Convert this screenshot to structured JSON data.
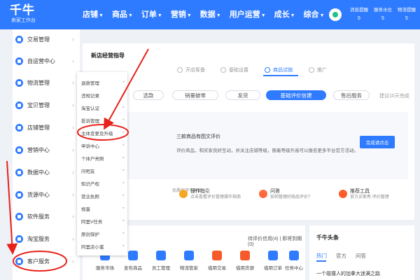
{
  "brand": {
    "logo": "千牛",
    "subtitle": "卖家工作台"
  },
  "nav": [
    "店铺",
    "商品",
    "订单",
    "营销",
    "数据",
    "用户运营",
    "成长",
    "综合"
  ],
  "user_stats": [
    {
      "label": "消息提醒",
      "value": "5"
    },
    {
      "label": "服务水位",
      "value": "5"
    },
    {
      "label": "物流提醒",
      "value": "5"
    }
  ],
  "sidebar": [
    "交易管理",
    "自运营中心",
    "物流管理",
    "宝贝管理",
    "店铺管理",
    "营销中心",
    "数据中心",
    "货源中心",
    "软件服务",
    "淘宝服务",
    "客户服务"
  ],
  "submenu": [
    "退款管理",
    "违规记录",
    "淘宝认证",
    "投诉管理",
    "主体变更及升级",
    "申诉中心",
    "个体户亮照",
    "问吧友",
    "知识产权",
    "营业执照",
    "规蛋",
    "阿里V任务",
    "原创保护",
    "阿里店小蜜"
  ],
  "main": {
    "section_title": "新店经营指导",
    "steps": [
      "开店筹备",
      "基础设置",
      "商品试销",
      "推广"
    ],
    "stages": [
      "选款",
      "销量破零",
      "发货",
      "基础评价信建",
      "售后服务"
    ],
    "stage_note": "建议10天完成",
    "task_line1": "三款商品有图文评价",
    "task_line2": "评价商品，和买家良好互动，并关注店铺等级，随着等级升高可以报名更多平台官方活动。",
    "task_button": "完成请点击",
    "tools": [
      {
        "title": "",
        "desc": "优质好评不再愁"
      },
      {
        "title": "操作指引",
        "desc": "点击查看评价管理操作指南"
      },
      {
        "title": "问答",
        "desc": "如何管理好商品评价？"
      },
      {
        "title": "推荐工具",
        "desc": "官方买家秀 评价管理"
      }
    ]
  },
  "quick_panel": {
    "header": "待评价信用(4) | 即将到期(0)",
    "items": [
      "服务市场",
      "发布商品",
      "员工管理",
      "物流管家",
      "借用交易",
      "借用货源",
      "借用订单",
      "任务中心"
    ]
  },
  "news": {
    "title": "千牛头条",
    "tabs": [
      "热门",
      "官方",
      "问答"
    ],
    "first_line": "一个碰撞人的加拿大迷满之路"
  },
  "colors": {
    "brand": "#2f7bff",
    "annotation": "#e8211a"
  }
}
